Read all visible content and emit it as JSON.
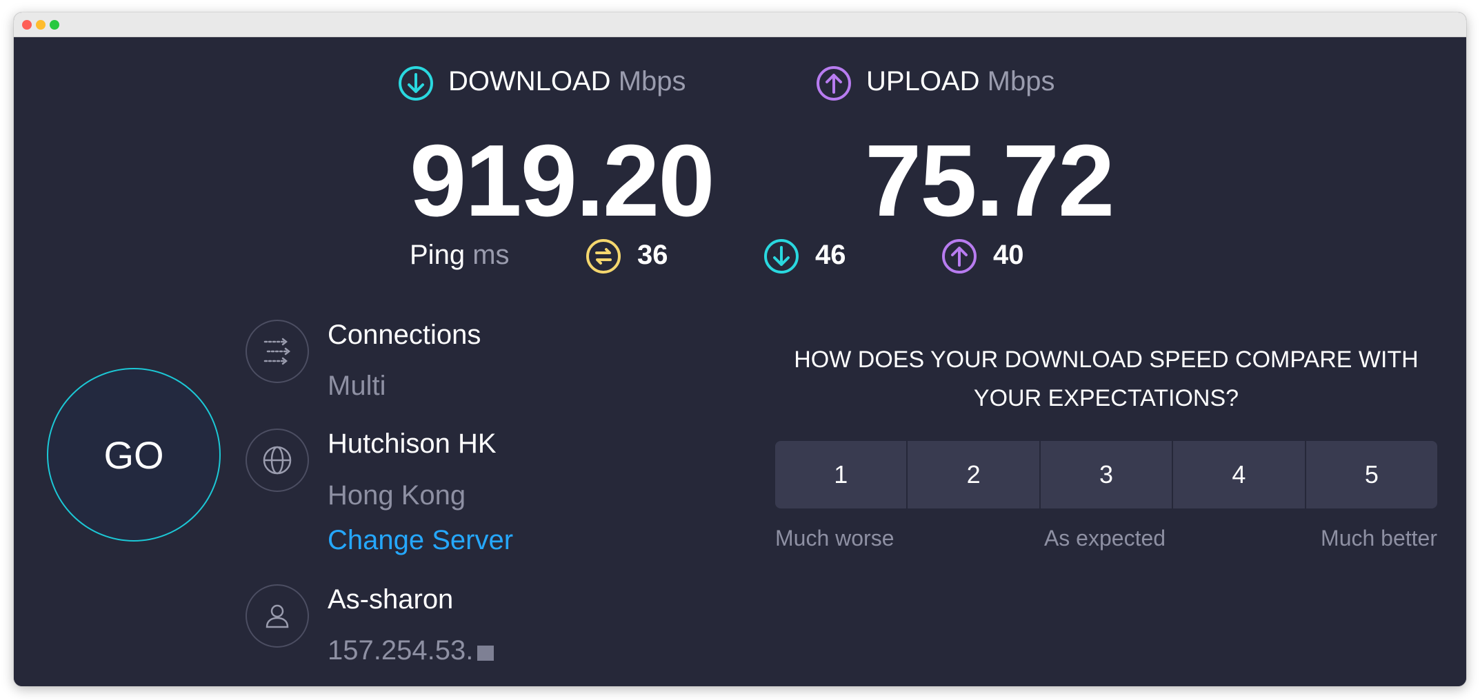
{
  "colors": {
    "background": "#262839",
    "download_accent": "#2ad8df",
    "upload_accent": "#b87cf0",
    "jitter_accent": "#f5d76e",
    "go_ring": "#1cc8d6",
    "link": "#25a8ff"
  },
  "download": {
    "label": "DOWNLOAD",
    "unit": "Mbps",
    "value": "919.20",
    "icon": "download-arrow-icon"
  },
  "upload": {
    "label": "UPLOAD",
    "unit": "Mbps",
    "value": "75.72",
    "icon": "upload-arrow-icon"
  },
  "ping": {
    "label": "Ping",
    "unit": "ms",
    "idle": {
      "value": "36",
      "icon": "jitter-icon"
    },
    "download": {
      "value": "46",
      "icon": "download-arrow-icon"
    },
    "upload": {
      "value": "40",
      "icon": "upload-arrow-icon"
    }
  },
  "go_button": {
    "label": "GO"
  },
  "connections": {
    "title": "Connections",
    "value": "Multi",
    "icon": "connections-icon"
  },
  "server": {
    "title": "Hutchison HK",
    "location": "Hong Kong",
    "change_label": "Change Server",
    "icon": "globe-icon"
  },
  "provider": {
    "title": "As-sharon",
    "ip": "157.254.53.",
    "icon": "user-icon"
  },
  "survey": {
    "question_line1": "HOW DOES YOUR DOWNLOAD SPEED COMPARE WITH",
    "question_line2": "YOUR EXPECTATIONS?",
    "options": [
      "1",
      "2",
      "3",
      "4",
      "5"
    ],
    "scale_low": "Much worse",
    "scale_mid": "As expected",
    "scale_high": "Much better"
  }
}
